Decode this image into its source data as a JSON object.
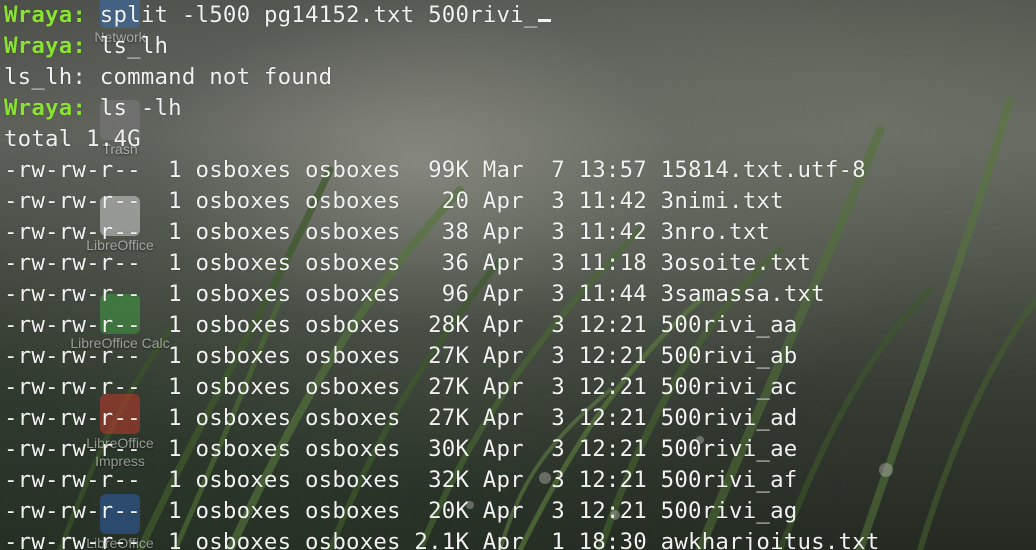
{
  "terminal": {
    "prompt": "Wraya:",
    "command_lines": [
      {
        "prompt": "Wraya:",
        "cmd": " split -l500 pg14152.txt 500rivi_"
      },
      {
        "prompt": "Wraya:",
        "cmd": " ls_lh"
      },
      {
        "prompt": "",
        "cmd": "ls_lh: command not found"
      },
      {
        "prompt": "Wraya:",
        "cmd": " ls -lh"
      },
      {
        "prompt": "",
        "cmd": "total 1.4G"
      }
    ],
    "listing": [
      "-rw-rw-r--  1 osboxes osboxes  99K Mar  7 13:57 15814.txt.utf-8",
      "-rw-rw-r--  1 osboxes osboxes   20 Apr  3 11:42 3nimi.txt",
      "-rw-rw-r--  1 osboxes osboxes   38 Apr  3 11:42 3nro.txt",
      "-rw-rw-r--  1 osboxes osboxes   36 Apr  3 11:18 3osoite.txt",
      "-rw-rw-r--  1 osboxes osboxes   96 Apr  3 11:44 3samassa.txt",
      "-rw-rw-r--  1 osboxes osboxes  28K Apr  3 12:21 500rivi_aa",
      "-rw-rw-r--  1 osboxes osboxes  27K Apr  3 12:21 500rivi_ab",
      "-rw-rw-r--  1 osboxes osboxes  27K Apr  3 12:21 500rivi_ac",
      "-rw-rw-r--  1 osboxes osboxes  27K Apr  3 12:21 500rivi_ad",
      "-rw-rw-r--  1 osboxes osboxes  30K Apr  3 12:21 500rivi_ae",
      "-rw-rw-r--  1 osboxes osboxes  32K Apr  3 12:21 500rivi_af",
      "-rw-rw-r--  1 osboxes osboxes  20K Apr  3 12:21 500rivi_ag",
      "-rw-rw-r--  1 osboxes osboxes 2.1K Apr  1 18:30 awkharjoitus.txt"
    ]
  },
  "desktop_icons": [
    {
      "label": "Network",
      "icon": "network-icon",
      "color": "#3b6fb0"
    },
    {
      "label": "Trash",
      "icon": "trash-icon",
      "color": "#8a8a8a"
    },
    {
      "label": "LibreOffice",
      "icon": "libreoffice-icon",
      "color": "#d8d8d8"
    },
    {
      "label": "LibreOffice Calc",
      "icon": "libreoffice-calc-icon",
      "color": "#3f9b3f"
    },
    {
      "label": "LibreOffice Impress",
      "icon": "libreoffice-impress-icon",
      "color": "#c0392b"
    },
    {
      "label": "LibreOffice",
      "icon": "libreoffice-writer-icon",
      "color": "#2f5fa8"
    }
  ],
  "colors": {
    "prompt": "#8ae234",
    "text": "#f2f2f2"
  }
}
